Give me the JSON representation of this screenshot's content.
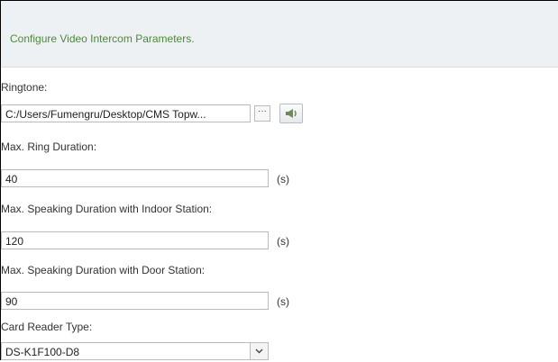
{
  "header": {
    "title": "Configure Video Intercom Parameters."
  },
  "ringtone": {
    "label": "Ringtone:",
    "value": "C:/Users/Fumengru/Desktop/CMS Topw...",
    "browse_label": "···",
    "play_icon": "speaker-icon"
  },
  "max_ring": {
    "label": "Max. Ring Duration:",
    "value": "40",
    "unit": "(s)"
  },
  "max_speak_indoor": {
    "label": "Max. Speaking Duration with Indoor Station:",
    "value": "120",
    "unit": "(s)"
  },
  "max_speak_door": {
    "label": "Max. Speaking Duration with Door Station:",
    "value": "90",
    "unit": "(s)"
  },
  "card_reader": {
    "label": "Card Reader Type:",
    "value": "DS-K1F100-D8",
    "arrow_icon": "chevron-down-icon"
  }
}
